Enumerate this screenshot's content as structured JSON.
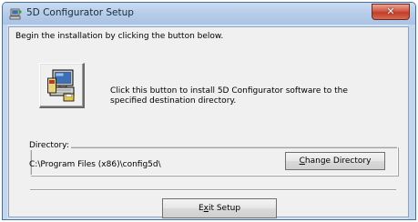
{
  "window": {
    "title": "5D Configurator Setup",
    "close_symbol": "✕"
  },
  "content": {
    "intro_text": "Begin the installation by clicking the button below.",
    "install_description": "Click this button to install 5D Configurator software to the specified destination directory."
  },
  "directory": {
    "label": "Directory:",
    "path": "C:\\Program Files (x86)\\config5d\\",
    "change_button_label": "Change Directory",
    "change_button_access_key": "C"
  },
  "exit_button": {
    "label": "Exit Setup",
    "access_key": "x"
  },
  "icons": {
    "title": "setup-computer-icon",
    "install": "computer-install-icon",
    "close": "close-icon"
  },
  "colors": {
    "close_button": "#c8432c",
    "titlebar": "#b6cde9",
    "dialog_background": "#f0f0f0"
  }
}
